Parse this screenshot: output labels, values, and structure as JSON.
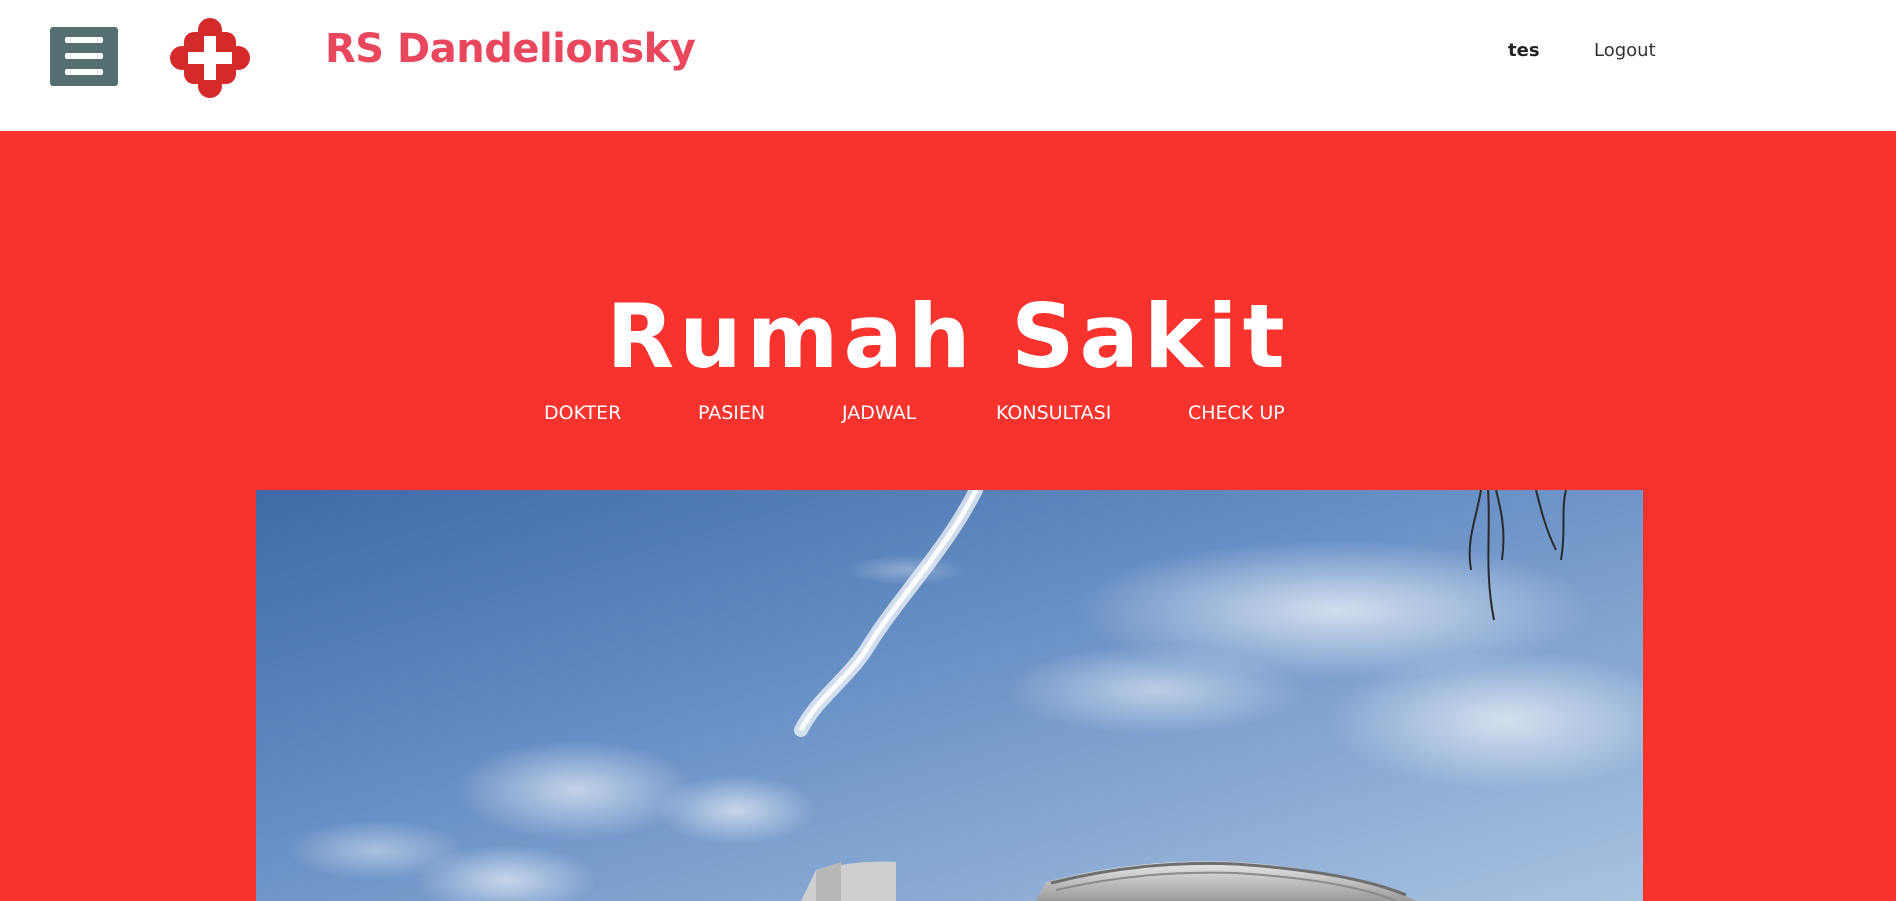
{
  "header": {
    "menu_icon": "hamburger-menu-icon",
    "logo_icon": "red-cross-icon",
    "brand": "RS Dandelionsky",
    "user": "tes",
    "logout": "Logout"
  },
  "hero": {
    "title": "Rumah Sakit",
    "nav": [
      "DOKTER",
      "PASIEN",
      "JADWAL",
      "KONSULTASI",
      "CHECK UP"
    ],
    "image": "hospital-building-photo"
  },
  "colors": {
    "brand": "#e8475d",
    "hero_bg": "#f8322d",
    "menu_button": "#546e72",
    "logo": "#d42a2a"
  }
}
